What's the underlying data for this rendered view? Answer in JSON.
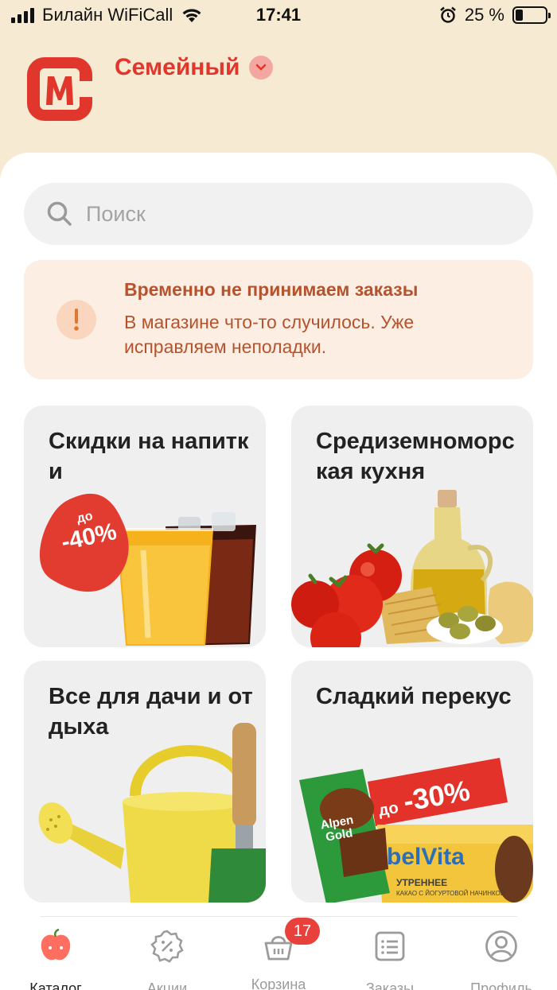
{
  "status_bar": {
    "carrier": "Билайн WiFiCall",
    "time": "17:41",
    "battery_percent": "25 %",
    "battery_level": 0.25
  },
  "header": {
    "logo_icon": "magnit-logo-icon",
    "store_name": "Семейный",
    "store_chevron_icon": "chevron-down-icon"
  },
  "search": {
    "placeholder": "Поиск",
    "value": ""
  },
  "alert": {
    "icon": "exclamation-icon",
    "title": "Временно не принимаем заказы",
    "text": "В магазине что-то случилось. Уже исправляем неполадки."
  },
  "catalog": {
    "cards": [
      {
        "title": "Скидки на напитки",
        "badge_top": "до",
        "badge_bottom": "-40%"
      },
      {
        "title": "Средиземноморская кухня"
      },
      {
        "title": "Все для дачи и отдыха"
      },
      {
        "title": "Сладкий перекус",
        "badge_top": "до",
        "badge_bottom": "-30%",
        "products": [
          "Alpen Gold",
          "belVita",
          "УТРЕННЕЕ",
          "КАКАО С ЙОГУРТОВОЙ НАЧИНКОЙ"
        ]
      }
    ]
  },
  "bottom_nav": {
    "items": [
      {
        "label": "Каталог",
        "icon": "apple-icon",
        "active": true
      },
      {
        "label": "Акции",
        "icon": "discount-badge-icon",
        "active": false
      },
      {
        "label": "Корзина",
        "icon": "basket-icon",
        "active": false,
        "badge": "17"
      },
      {
        "label": "Заказы",
        "icon": "orders-list-icon",
        "active": false
      },
      {
        "label": "Профиль",
        "icon": "user-circle-icon",
        "active": false
      }
    ]
  },
  "colors": {
    "brand_red": "#e1362c",
    "header_bg": "#f7ead3",
    "alert_bg": "#fdeee3",
    "alert_text": "#b4532d",
    "card_bg": "#efefef"
  }
}
